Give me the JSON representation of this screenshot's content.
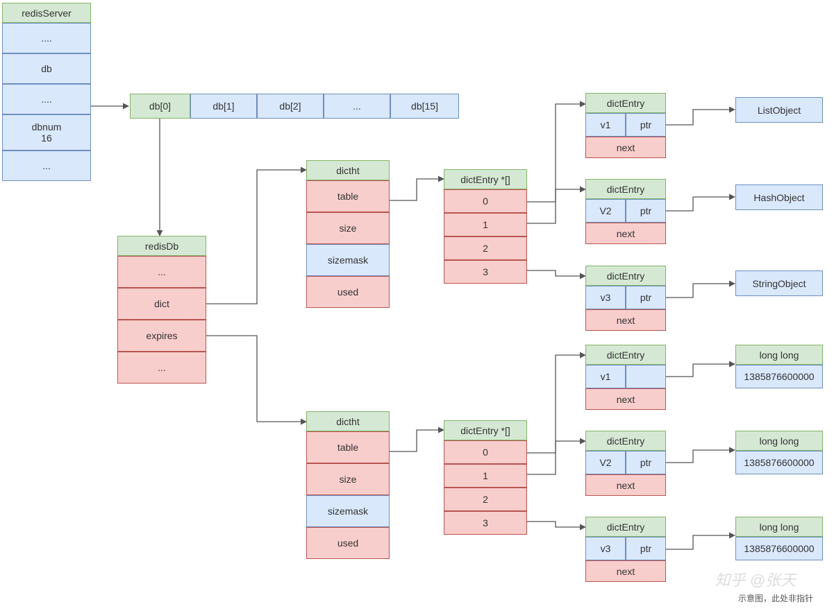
{
  "redisServer": {
    "title": "redisServer",
    "rows": [
      "....",
      "db",
      "....",
      "dbnum\n16",
      "..."
    ]
  },
  "dbArray": [
    "db[0]",
    "db[1]",
    "db[2]",
    "...",
    "db[15]"
  ],
  "redisDb": {
    "title": "redisDb",
    "rows": [
      "...",
      "dict",
      "expires",
      "..."
    ]
  },
  "dictht1": {
    "title": "dictht",
    "rows": [
      "table",
      "size",
      "sizemask",
      "used"
    ]
  },
  "dictht2": {
    "title": "dictht",
    "rows": [
      "table",
      "size",
      "sizemask",
      "used"
    ]
  },
  "entryArr1": {
    "title": "dictEntry *[]",
    "rows": [
      "0",
      "1",
      "2",
      "3"
    ]
  },
  "entryArr2": {
    "title": "dictEntry *[]",
    "rows": [
      "0",
      "1",
      "2",
      "3"
    ]
  },
  "dictEntry": {
    "title": "dictEntry",
    "ptr": "ptr",
    "next": "next"
  },
  "entries1": [
    {
      "key": "v1"
    },
    {
      "key": "V2"
    },
    {
      "key": "v3"
    }
  ],
  "entries2": [
    {
      "key": "v1",
      "ptr": ""
    },
    {
      "key": "V2"
    },
    {
      "key": "v3"
    }
  ],
  "objects": [
    "ListObject",
    "HashObject",
    "StringObject"
  ],
  "longlong": {
    "title": "long long",
    "value": "1385876600000"
  },
  "footer": "示意图，此处非指针",
  "watermark": "知乎 @张天"
}
